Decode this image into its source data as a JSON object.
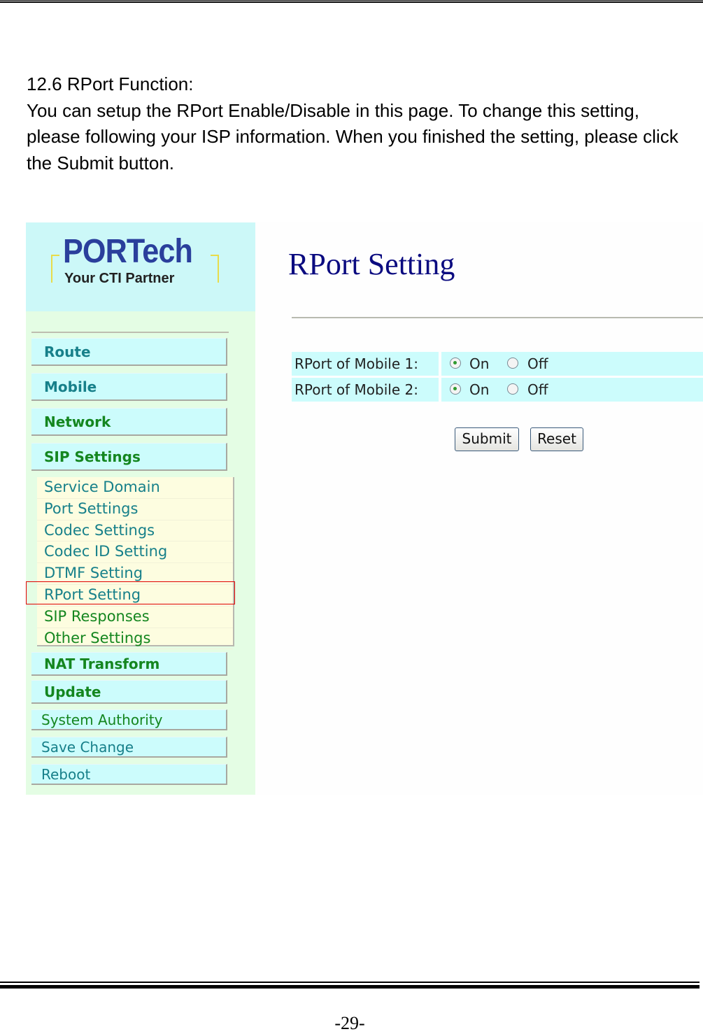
{
  "document": {
    "section_heading": "12.6 RPort Function:",
    "paragraph": "You can setup the RPort Enable/Disable in this page. To change this setting, please following your ISP information. When you finished the setting, please click the Submit button.",
    "page_number": "-29-"
  },
  "screenshot": {
    "logo": {
      "brand": "PORTech",
      "tagline": "Your CTI Partner"
    },
    "sidebar": {
      "main_items": [
        {
          "label": "Route"
        },
        {
          "label": "Mobile"
        },
        {
          "label": "Network"
        },
        {
          "label": "SIP Settings"
        }
      ],
      "sip_submenu": [
        {
          "label": "Service Domain"
        },
        {
          "label": "Port Settings"
        },
        {
          "label": "Codec Settings"
        },
        {
          "label": "Codec ID Setting"
        },
        {
          "label": "DTMF Setting"
        },
        {
          "label": "RPort Setting",
          "highlighted": true
        },
        {
          "label": "SIP Responses"
        },
        {
          "label": "Other Settings"
        }
      ],
      "lower_items": [
        {
          "label": "NAT Transform"
        },
        {
          "label": "Update"
        },
        {
          "label": "System Authority"
        },
        {
          "label": "Save Change"
        },
        {
          "label": "Reboot"
        }
      ]
    },
    "main": {
      "title": "RPort Setting",
      "rows": [
        {
          "label": "RPort of Mobile 1:",
          "options": [
            "On",
            "Off"
          ],
          "selected": "On"
        },
        {
          "label": "RPort of Mobile 2:",
          "options": [
            "On",
            "Off"
          ],
          "selected": "On"
        }
      ],
      "buttons": {
        "submit": "Submit",
        "reset": "Reset"
      }
    },
    "colors": {
      "highlight_box": "#e00000",
      "title": "#0b0b80",
      "nav_bg": "#ccfcfc",
      "sidebar_bg": "#e4fde4"
    }
  }
}
